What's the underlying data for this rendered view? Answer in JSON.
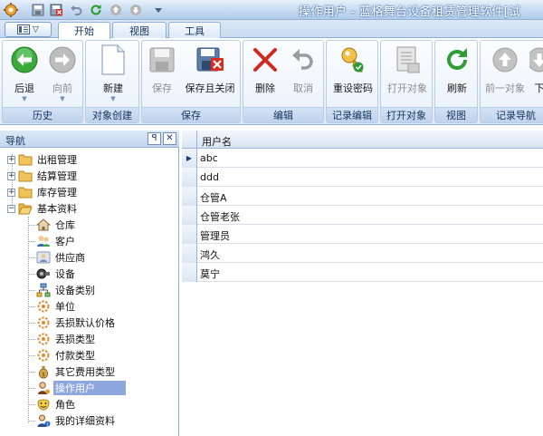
{
  "window": {
    "title": "操作用户 - 蓝格舞台设备租赁管理软件[试"
  },
  "quick_access": [
    "app-gear-icon",
    "save-icon",
    "save-close-icon",
    "undo-icon",
    "refresh-icon",
    "up-icon",
    "down-icon",
    "customize-icon"
  ],
  "tabs": [
    {
      "label": "开始",
      "active": true
    },
    {
      "label": "视图",
      "active": false
    },
    {
      "label": "工具",
      "active": false
    }
  ],
  "ribbon": {
    "groups": [
      {
        "label": "历史",
        "buttons": [
          {
            "label": "后退",
            "icon": "back-arrow-icon",
            "enabled": true,
            "dropdown": true
          },
          {
            "label": "向前",
            "icon": "forward-arrow-icon",
            "enabled": false,
            "dropdown": true
          }
        ]
      },
      {
        "label": "对象创建",
        "buttons": [
          {
            "label": "新建",
            "icon": "new-document-icon",
            "enabled": true,
            "dropdown": true
          }
        ]
      },
      {
        "label": "保存",
        "buttons": [
          {
            "label": "保存",
            "icon": "save-icon",
            "enabled": false
          },
          {
            "label": "保存且关闭",
            "icon": "save-close-icon",
            "enabled": true
          }
        ]
      },
      {
        "label": "编辑",
        "buttons": [
          {
            "label": "删除",
            "icon": "delete-icon",
            "enabled": true
          },
          {
            "label": "取消",
            "icon": "undo-icon",
            "enabled": false
          }
        ]
      },
      {
        "label": "记录编辑",
        "buttons": [
          {
            "label": "重设密码",
            "icon": "reset-password-icon",
            "enabled": true
          }
        ]
      },
      {
        "label": "打开对象",
        "buttons": [
          {
            "label": "打开对象",
            "icon": "open-object-icon",
            "enabled": false
          }
        ]
      },
      {
        "label": "视图",
        "buttons": [
          {
            "label": "刷新",
            "icon": "refresh-icon",
            "enabled": true
          }
        ]
      },
      {
        "label": "记录导航",
        "buttons": [
          {
            "label": "前一对象",
            "icon": "up-arrow-icon",
            "enabled": false
          },
          {
            "label": "下",
            "icon": "down-arrow-icon",
            "enabled": true
          }
        ]
      }
    ]
  },
  "navigation": {
    "title": "导航",
    "pin_glyph": "ꟼ",
    "close_glyph": "✕",
    "items": [
      {
        "label": "出租管理",
        "icon": "folder-icon",
        "level": 0,
        "expander": "+"
      },
      {
        "label": "结算管理",
        "icon": "folder-icon",
        "level": 0,
        "expander": "+"
      },
      {
        "label": "库存管理",
        "icon": "folder-icon",
        "level": 0,
        "expander": "+"
      },
      {
        "label": "基本资料",
        "icon": "folder-open-icon",
        "level": 0,
        "expander": "−"
      },
      {
        "label": "仓库",
        "icon": "house-icon",
        "level": 1
      },
      {
        "label": "客户",
        "icon": "customer-icon",
        "level": 1
      },
      {
        "label": "供应商",
        "icon": "supplier-icon",
        "level": 1
      },
      {
        "label": "设备",
        "icon": "equipment-icon",
        "level": 1
      },
      {
        "label": "设备类别",
        "icon": "category-icon",
        "level": 1
      },
      {
        "label": "单位",
        "icon": "unit-icon",
        "level": 1
      },
      {
        "label": "丢损默认价格",
        "icon": "loss-price-icon",
        "level": 1
      },
      {
        "label": "丢损类型",
        "icon": "loss-type-icon",
        "level": 1
      },
      {
        "label": "付款类型",
        "icon": "payment-type-icon",
        "level": 1
      },
      {
        "label": "其它费用类型",
        "icon": "money-bag-icon",
        "level": 1
      },
      {
        "label": "操作用户",
        "icon": "user-icon",
        "level": 1,
        "selected": true
      },
      {
        "label": "角色",
        "icon": "role-icon",
        "level": 1
      },
      {
        "label": "我的详细资料",
        "icon": "my-details-icon",
        "level": 1
      }
    ]
  },
  "grid": {
    "columns": [
      "用户名"
    ],
    "rows": [
      "abc",
      "ddd",
      "仓管A",
      "仓管老张",
      "管理员",
      "鸿久",
      "莫宁"
    ],
    "current_row_glyph": "▶"
  },
  "colors": {
    "ribbon_border": "#8fb0d8",
    "selected_item": "#8ea7df",
    "title_text": "#ffffff"
  }
}
